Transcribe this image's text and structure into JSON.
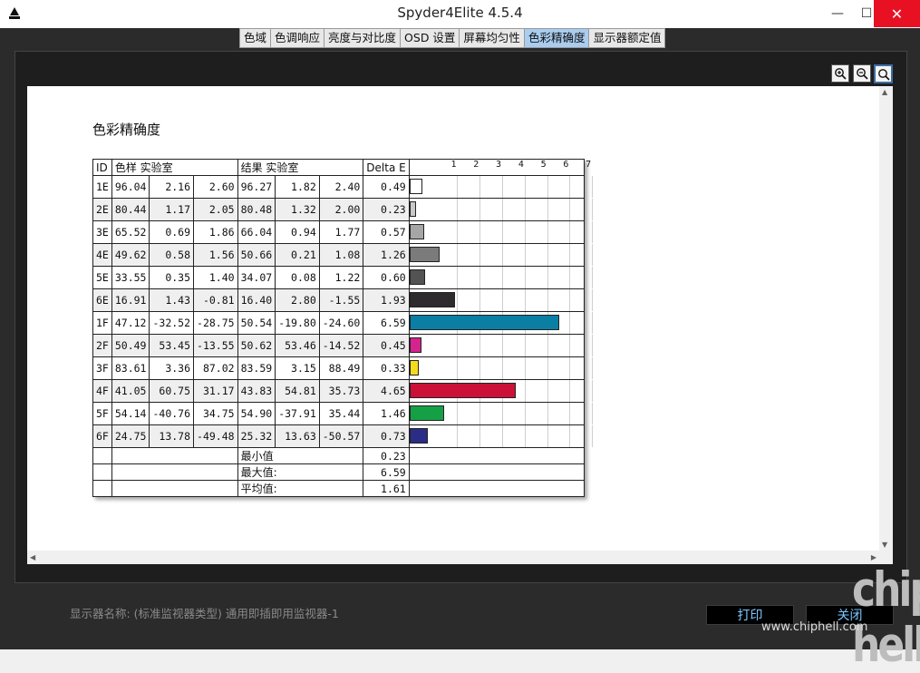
{
  "window": {
    "title": "Spyder4Elite 4.5.4",
    "min_label": "—",
    "max_label": "☐",
    "close_label": "✕"
  },
  "tabs": [
    {
      "label": "色域",
      "active": false
    },
    {
      "label": "色调响应",
      "active": false
    },
    {
      "label": "亮度与对比度",
      "active": false
    },
    {
      "label": "OSD 设置",
      "active": false
    },
    {
      "label": "屏幕均匀性",
      "active": false
    },
    {
      "label": "色彩精确度",
      "active": true
    },
    {
      "label": "显示器额定值",
      "active": false
    }
  ],
  "zoom_icons": [
    "zoom-in-icon",
    "zoom-out-icon",
    "zoom-fit-icon"
  ],
  "report": {
    "title": "色彩精确度",
    "headers": {
      "id": "ID",
      "sample": "色样 实验室",
      "result": "结果 实验室",
      "delta": "Delta E"
    },
    "axis_ticks": [
      "1",
      "2",
      "3",
      "4",
      "5",
      "6",
      "7"
    ],
    "rows": [
      {
        "id": "1E",
        "s": [
          "96.04",
          "2.16",
          "2.60"
        ],
        "r": [
          "96.27",
          "1.82",
          "2.40"
        ],
        "delta": 0.49,
        "delta_text": "0.49",
        "color": "#ffffff"
      },
      {
        "id": "2E",
        "s": [
          "80.44",
          "1.17",
          "2.05"
        ],
        "r": [
          "80.48",
          "1.32",
          "2.00"
        ],
        "delta": 0.23,
        "delta_text": "0.23",
        "color": "#c9c9c9"
      },
      {
        "id": "3E",
        "s": [
          "65.52",
          "0.69",
          "1.86"
        ],
        "r": [
          "66.04",
          "0.94",
          "1.77"
        ],
        "delta": 0.57,
        "delta_text": "0.57",
        "color": "#a6a6a6"
      },
      {
        "id": "4E",
        "s": [
          "49.62",
          "0.58",
          "1.56"
        ],
        "r": [
          "50.66",
          "0.21",
          "1.08"
        ],
        "delta": 1.26,
        "delta_text": "1.26",
        "color": "#7b7b7b"
      },
      {
        "id": "5E",
        "s": [
          "33.55",
          "0.35",
          "1.40"
        ],
        "r": [
          "34.07",
          "0.08",
          "1.22"
        ],
        "delta": 0.6,
        "delta_text": "0.60",
        "color": "#535353"
      },
      {
        "id": "6E",
        "s": [
          "16.91",
          "1.43",
          "-0.81"
        ],
        "r": [
          "16.40",
          "2.80",
          "-1.55"
        ],
        "delta": 1.93,
        "delta_text": "1.93",
        "color": "#2e2a2d"
      },
      {
        "id": "1F",
        "s": [
          "47.12",
          "-32.52",
          "-28.75"
        ],
        "r": [
          "50.54",
          "-19.80",
          "-24.60"
        ],
        "delta": 6.59,
        "delta_text": "6.59",
        "color": "#0a7fa3"
      },
      {
        "id": "2F",
        "s": [
          "50.49",
          "53.45",
          "-13.55"
        ],
        "r": [
          "50.62",
          "53.46",
          "-14.52"
        ],
        "delta": 0.45,
        "delta_text": "0.45",
        "color": "#d4238f"
      },
      {
        "id": "3F",
        "s": [
          "83.61",
          "3.36",
          "87.02"
        ],
        "r": [
          "83.59",
          "3.15",
          "88.49"
        ],
        "delta": 0.33,
        "delta_text": "0.33",
        "color": "#f4dc1c"
      },
      {
        "id": "4F",
        "s": [
          "41.05",
          "60.75",
          "31.17"
        ],
        "r": [
          "43.83",
          "54.81",
          "35.73"
        ],
        "delta": 4.65,
        "delta_text": "4.65",
        "color": "#cc1139"
      },
      {
        "id": "5F",
        "s": [
          "54.14",
          "-40.76",
          "34.75"
        ],
        "r": [
          "54.90",
          "-37.91",
          "35.44"
        ],
        "delta": 1.46,
        "delta_text": "1.46",
        "color": "#16a046"
      },
      {
        "id": "6F",
        "s": [
          "24.75",
          "13.78",
          "-49.48"
        ],
        "r": [
          "25.32",
          "13.63",
          "-50.57"
        ],
        "delta": 0.73,
        "delta_text": "0.73",
        "color": "#2b2c86"
      }
    ],
    "stats": [
      {
        "label": "最小值",
        "value": "0.23"
      },
      {
        "label": "最大值:",
        "value": "6.59"
      },
      {
        "label": "平均值:",
        "value": "1.61"
      }
    ]
  },
  "footer": {
    "monitor_name_label": "显示器名称: (标准监视器类型) 通用即插即用监视器-1",
    "print_button": "打印",
    "close_button": "关闭"
  },
  "watermark": {
    "url": "www.chiphell.com",
    "logo": "chip hell"
  }
}
